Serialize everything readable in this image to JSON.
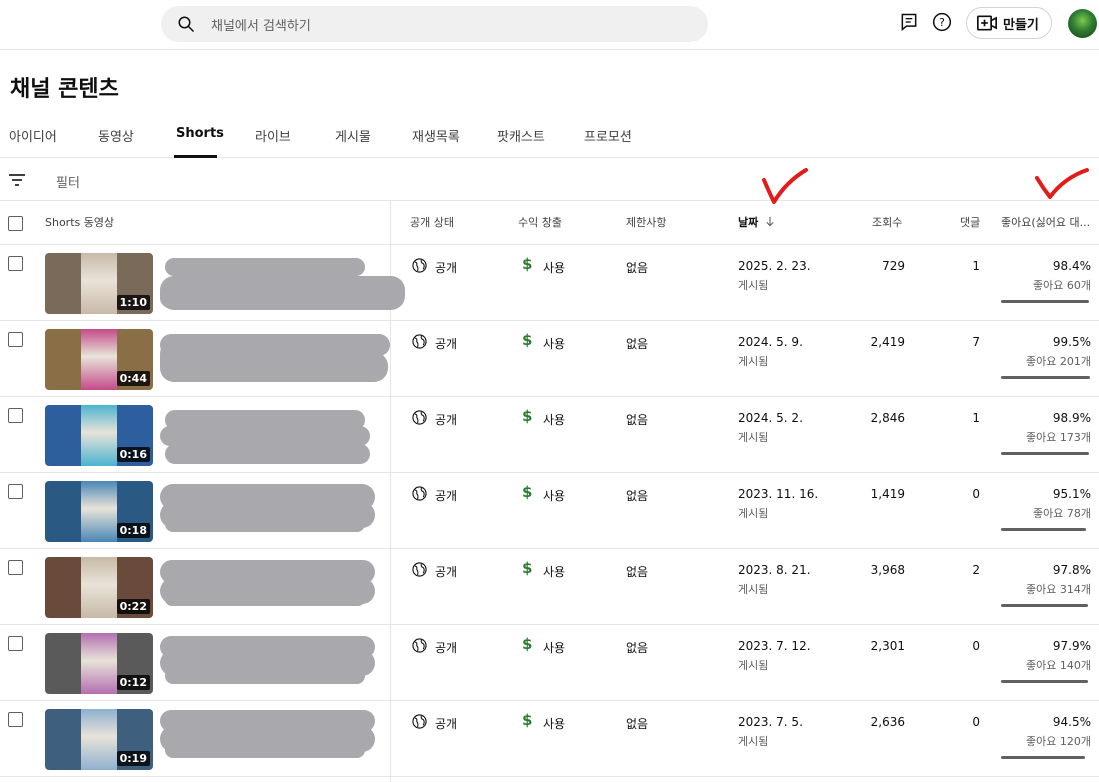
{
  "header": {
    "search_placeholder": "채널에서 검색하기",
    "create_label": "만들기"
  },
  "page_title": "채널 콘텐츠",
  "tabs": [
    {
      "label": "아이디어"
    },
    {
      "label": "동영상"
    },
    {
      "label": "Shorts",
      "active": true
    },
    {
      "label": "라이브"
    },
    {
      "label": "게시물"
    },
    {
      "label": "재생목록"
    },
    {
      "label": "팟캐스트"
    },
    {
      "label": "프로모션"
    }
  ],
  "filter_label": "필터",
  "columns": {
    "video": "Shorts 동영상",
    "visibility": "공개 상태",
    "monetization": "수익 창출",
    "restrictions": "제한사항",
    "date": "날짜",
    "views": "조회수",
    "comments": "댓글",
    "likes": "좋아요(싫어요 대..."
  },
  "rows": [
    {
      "duration": "1:10",
      "visibility": "공개",
      "monetization": "사용",
      "restrictions": "없음",
      "date": "2025. 2. 23.",
      "date_sub": "게시됨",
      "views": "729",
      "comments": "1",
      "like_pct": "98.4%",
      "like_count": "좋아요 60개",
      "like_ratio": 0.984
    },
    {
      "duration": "0:44",
      "visibility": "공개",
      "monetization": "사용",
      "restrictions": "없음",
      "date": "2024. 5. 9.",
      "date_sub": "게시됨",
      "views": "2,419",
      "comments": "7",
      "like_pct": "99.5%",
      "like_count": "좋아요 201개",
      "like_ratio": 0.995
    },
    {
      "duration": "0:16",
      "visibility": "공개",
      "monetization": "사용",
      "restrictions": "없음",
      "date": "2024. 5. 2.",
      "date_sub": "게시됨",
      "views": "2,846",
      "comments": "1",
      "like_pct": "98.9%",
      "like_count": "좋아요 173개",
      "like_ratio": 0.989
    },
    {
      "duration": "0:18",
      "visibility": "공개",
      "monetization": "사용",
      "restrictions": "없음",
      "date": "2023. 11. 16.",
      "date_sub": "게시됨",
      "views": "1,419",
      "comments": "0",
      "like_pct": "95.1%",
      "like_count": "좋아요 78개",
      "like_ratio": 0.951
    },
    {
      "duration": "0:22",
      "visibility": "공개",
      "monetization": "사용",
      "restrictions": "없음",
      "date": "2023. 8. 21.",
      "date_sub": "게시됨",
      "views": "3,968",
      "comments": "2",
      "like_pct": "97.8%",
      "like_count": "좋아요 314개",
      "like_ratio": 0.978
    },
    {
      "duration": "0:12",
      "visibility": "공개",
      "monetization": "사용",
      "restrictions": "없음",
      "date": "2023. 7. 12.",
      "date_sub": "게시됨",
      "views": "2,301",
      "comments": "0",
      "like_pct": "97.9%",
      "like_count": "좋아요 140개",
      "like_ratio": 0.979
    },
    {
      "duration": "0:19",
      "visibility": "공개",
      "monetization": "사용",
      "restrictions": "없음",
      "date": "2023. 7. 5.",
      "date_sub": "게시됨",
      "views": "2,636",
      "comments": "0",
      "like_pct": "94.5%",
      "like_count": "좋아요 120개",
      "like_ratio": 0.945
    }
  ],
  "colors": {
    "accent_red": "#e21b1b",
    "money_green": "#2e7d32",
    "redaction_gray": "#a9a9ad"
  },
  "icons": [
    "search-icon",
    "feedback-icon",
    "help-icon",
    "create-video-icon",
    "filter-icon",
    "globe-icon",
    "dollar-icon",
    "sort-down-arrow-icon",
    "red-checkmark-annotation"
  ]
}
